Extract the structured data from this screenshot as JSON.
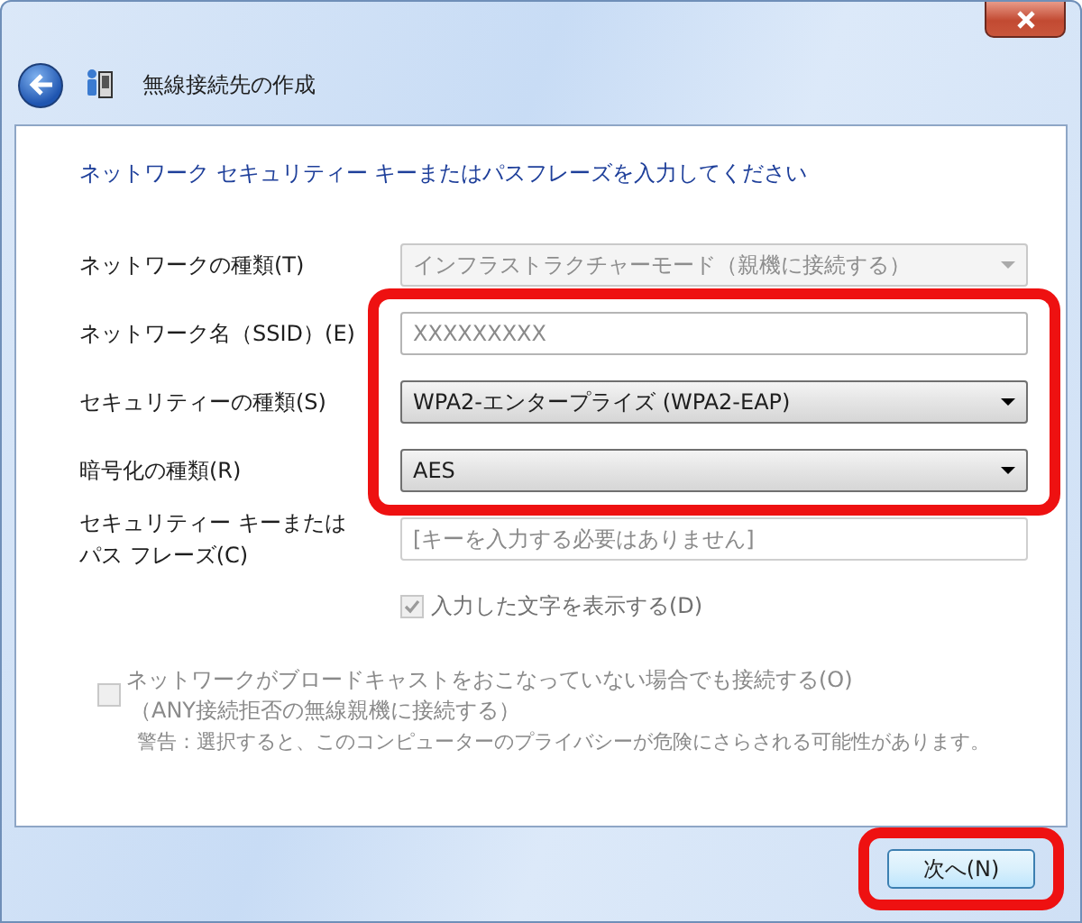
{
  "window": {
    "title": "無線接続先の作成"
  },
  "heading": "ネットワーク セキュリティー キーまたはパスフレーズを入力してください",
  "fields": [
    {
      "label": "ネットワークの種類(T)",
      "kind": "dropdown",
      "value": "インフラストラクチャーモード（親機に接続する）",
      "disabled": true,
      "highlighted": false
    },
    {
      "label": "ネットワーク名（SSID）(E)",
      "kind": "text",
      "placeholder": "XXXXXXXXX",
      "disabled": false,
      "highlighted": true
    },
    {
      "label": "セキュリティーの種類(S)",
      "kind": "dropdown",
      "value": "WPA2-エンタープライズ (WPA2-EAP)",
      "disabled": false,
      "highlighted": true
    },
    {
      "label": "暗号化の種類(R)",
      "kind": "dropdown",
      "value": "AES",
      "disabled": false,
      "highlighted": true
    },
    {
      "label_lines": [
        "セキュリティー キーまたは",
        "パス フレーズ(C)"
      ],
      "kind": "text",
      "placeholder": "[キーを入力する必要はありません]",
      "disabled": true,
      "highlighted": false
    }
  ],
  "show_characters": {
    "label": "入力した文字を表示する(D)",
    "checked": true,
    "disabled": true
  },
  "broadcast": {
    "label": "ネットワークがブロードキャストをおこなっていない場合でも接続する(O)",
    "note": "（ANY接続拒否の無線親機に接続する）",
    "checked": false,
    "disabled": true
  },
  "warning": "警告：選択すると、このコンピューターのプライバシーが危険にさらされる可能性があります。",
  "next_button": {
    "label": "次へ(N)",
    "highlighted": true
  }
}
